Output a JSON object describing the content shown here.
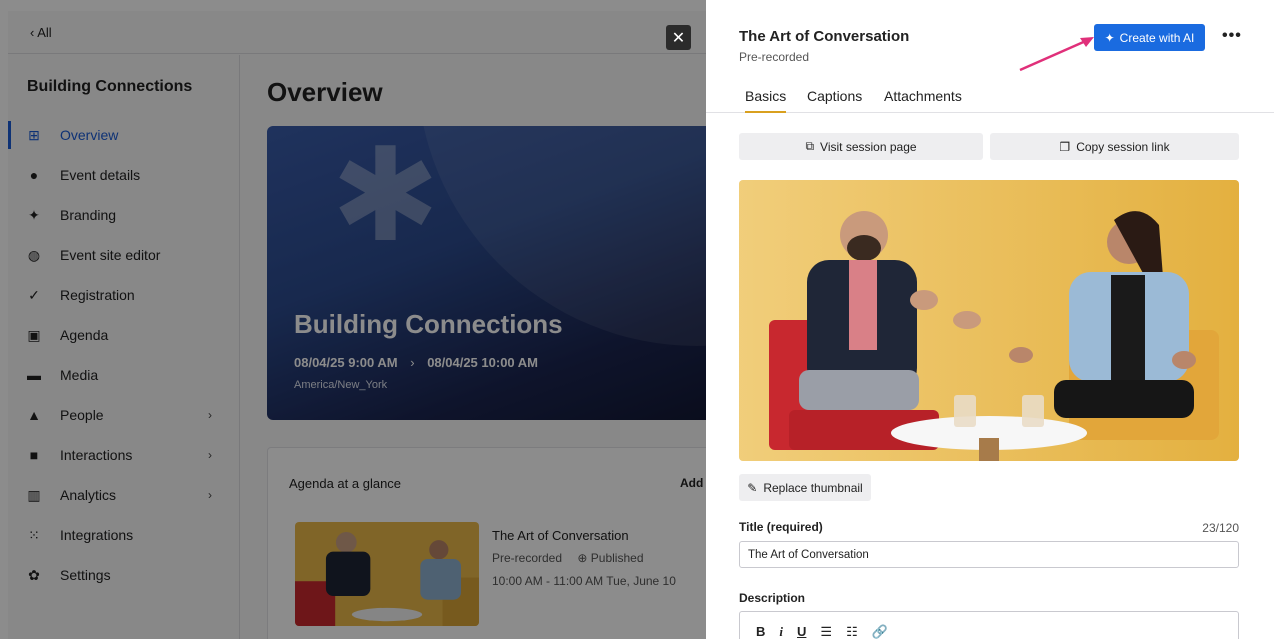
{
  "app": {
    "back_label": "‹  All",
    "event_name": "Building Connections",
    "nav": [
      {
        "label": "Overview",
        "icon": "grid-icon",
        "active": true,
        "chevron": false
      },
      {
        "label": "Event details",
        "icon": "info-icon",
        "active": false,
        "chevron": false
      },
      {
        "label": "Branding",
        "icon": "sparkle-icon",
        "active": false,
        "chevron": false
      },
      {
        "label": "Event site editor",
        "icon": "globe-icon",
        "active": false,
        "chevron": false
      },
      {
        "label": "Registration",
        "icon": "check-icon",
        "active": false,
        "chevron": false
      },
      {
        "label": "Agenda",
        "icon": "calendar-icon",
        "active": false,
        "chevron": false
      },
      {
        "label": "Media",
        "icon": "folder-icon",
        "active": false,
        "chevron": false
      },
      {
        "label": "People",
        "icon": "person-icon",
        "active": false,
        "chevron": true
      },
      {
        "label": "Interactions",
        "icon": "chat-icon",
        "active": false,
        "chevron": true
      },
      {
        "label": "Analytics",
        "icon": "bar-chart-icon",
        "active": false,
        "chevron": true
      },
      {
        "label": "Integrations",
        "icon": "plug-icon",
        "active": false,
        "chevron": false
      },
      {
        "label": "Settings",
        "icon": "gear-icon",
        "active": false,
        "chevron": false
      }
    ],
    "page_title": "Overview",
    "hero": {
      "title": "Building Connections",
      "start": "08/04/25 9:00 AM",
      "end": "08/04/25 10:00 AM",
      "timezone": "America/New_York"
    },
    "agenda": {
      "title": "Agenda at a glance",
      "add_label": "Add s",
      "session_title": "The Art of Conversation",
      "session_type": "Pre-recorded",
      "session_status": "Published",
      "session_time": "10:00 AM - 11:00 AM Tue, June 10"
    }
  },
  "panel": {
    "title": "The Art of Conversation",
    "subtitle": "Pre-recorded",
    "ai_button": "Create with AI",
    "more_icon": "more-icon",
    "tabs": [
      "Basics",
      "Captions",
      "Attachments"
    ],
    "visit_button": "Visit session page",
    "copy_button": "Copy session link",
    "replace_button": "Replace thumbnail",
    "title_field": {
      "label": "Title (required)",
      "count": "23/120",
      "value": "The Art of Conversation"
    },
    "description_label": "Description",
    "toolbar": [
      "B",
      "i",
      "U",
      "☰",
      "☷",
      "🔗"
    ]
  },
  "colors": {
    "accent": "#1a6be0",
    "tab_underline": "#d9a01f",
    "annotation_arrow": "#e0307a",
    "nav_active": "#1a5bd6"
  }
}
